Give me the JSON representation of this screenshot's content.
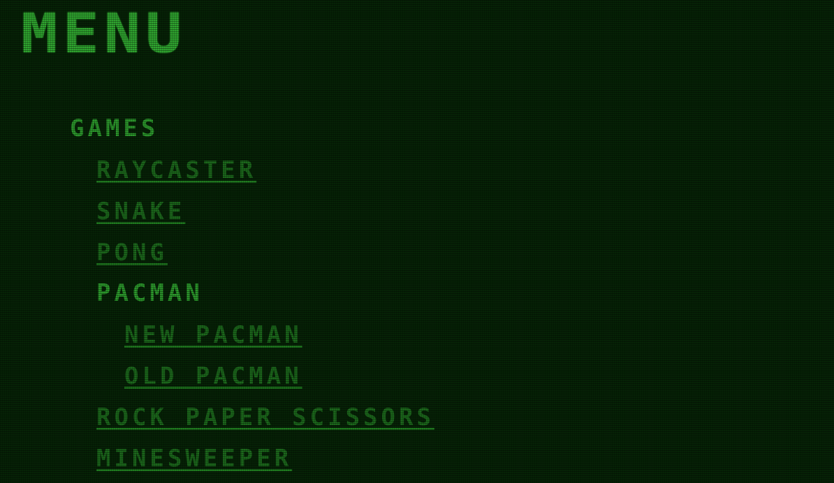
{
  "menu": {
    "title": "MENU",
    "section": "GAMES",
    "items": [
      {
        "label": "RAYCASTER",
        "type": "link"
      },
      {
        "label": "SNAKE",
        "type": "link"
      },
      {
        "label": "PONG",
        "type": "link"
      },
      {
        "label": "PACMAN",
        "type": "label"
      },
      {
        "label": "NEW PACMAN",
        "type": "link"
      },
      {
        "label": "OLD PACMAN",
        "type": "link"
      },
      {
        "label": "ROCK PAPER SCISSORS",
        "type": "link"
      },
      {
        "label": "MINESWEEPER",
        "type": "link"
      }
    ]
  },
  "colors": {
    "background": "#062306",
    "text": "#2c9a2c",
    "link": "#1c6a1c"
  }
}
